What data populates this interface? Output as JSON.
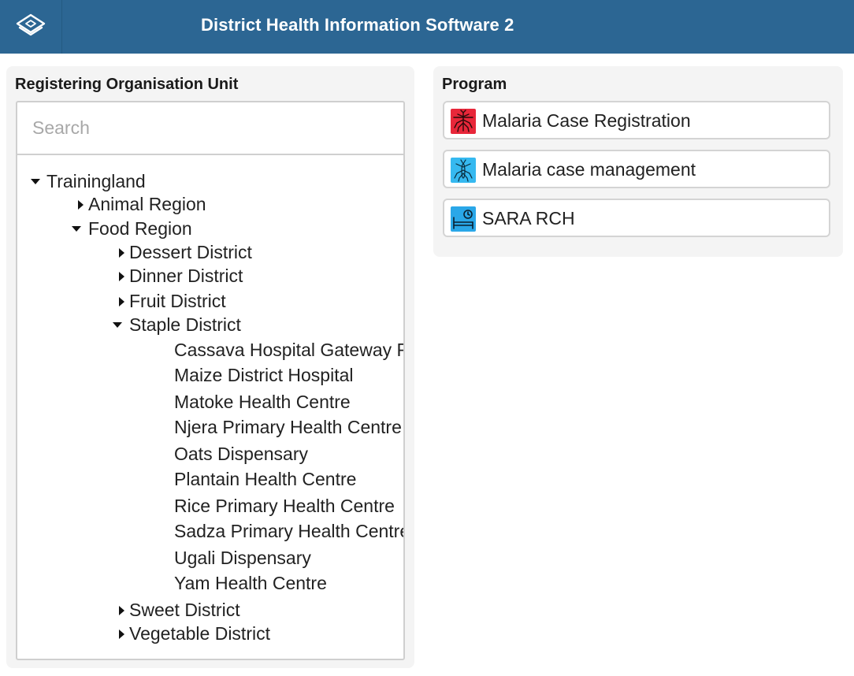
{
  "header": {
    "title": "District Health Information Software 2",
    "logo_icon": "dhis2-logo-icon",
    "background": "#2c6693"
  },
  "org_unit": {
    "title": "Registering Organisation Unit",
    "search_placeholder": "Search",
    "tree": [
      {
        "label": "Trainingland",
        "state": "expanded"
      },
      {
        "label": "Animal Region",
        "state": "collapsed"
      },
      {
        "label": "Food Region",
        "state": "expanded"
      },
      {
        "label": "Dessert District",
        "state": "collapsed"
      },
      {
        "label": "Dinner District",
        "state": "collapsed"
      },
      {
        "label": "Fruit District",
        "state": "collapsed"
      },
      {
        "label": "Staple District",
        "state": "expanded"
      },
      {
        "label": "Cassava Hospital Gateway F",
        "state": "leaf"
      },
      {
        "label": "Maize District Hospital",
        "state": "leaf"
      },
      {
        "label": "Matoke Health Centre",
        "state": "leaf"
      },
      {
        "label": "Njera Primary Health Centre",
        "state": "leaf"
      },
      {
        "label": "Oats Dispensary",
        "state": "leaf"
      },
      {
        "label": "Plantain Health Centre",
        "state": "leaf"
      },
      {
        "label": "Rice Primary Health Centre",
        "state": "leaf"
      },
      {
        "label": "Sadza Primary Health Centre",
        "state": "leaf"
      },
      {
        "label": "Ugali Dispensary",
        "state": "leaf"
      },
      {
        "label": "Yam Health Centre",
        "state": "leaf"
      },
      {
        "label": "Sweet District",
        "state": "collapsed"
      },
      {
        "label": "Vegetable District",
        "state": "collapsed"
      }
    ]
  },
  "program": {
    "title": "Program",
    "items": [
      {
        "label": "Malaria Case Registration",
        "icon": "mosquito-icon",
        "color": "#e8273a"
      },
      {
        "label": "Malaria case management",
        "icon": "mosquito-icon",
        "color": "#36b9f0"
      },
      {
        "label": "SARA RCH",
        "icon": "clinic-bed-icon",
        "color": "#2aa7e8"
      }
    ]
  }
}
